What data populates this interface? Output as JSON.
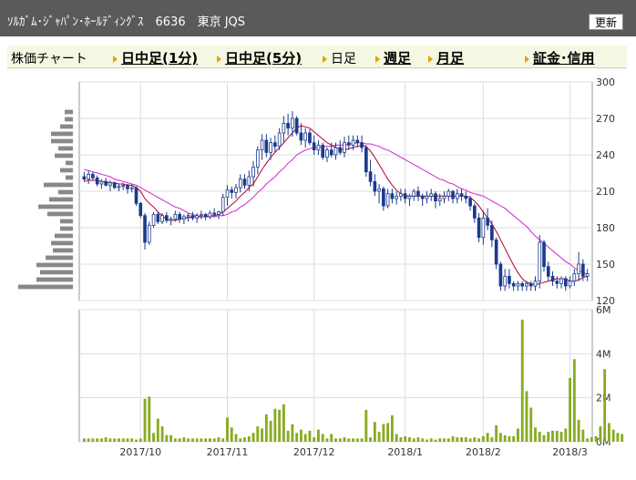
{
  "title_bar": {
    "title": "ｿﾙｶﾞﾑ･ｼﾞｬﾊﾟﾝ･ﾎｰﾙﾃﾞｨﾝｸﾞｽ　6636　東京 JQS",
    "refresh_label": "更新"
  },
  "nav": {
    "label": "株価チャート",
    "items": [
      {
        "label": "日中足(1分)",
        "link": true
      },
      {
        "label": "日中足(5分)",
        "link": true
      },
      {
        "label": "日足",
        "link": false
      },
      {
        "label": "週足",
        "link": true
      },
      {
        "label": "月足",
        "link": true
      },
      {
        "label": "証金･信用",
        "link": true
      }
    ]
  },
  "colors": {
    "up_candle": "#ffffff",
    "down_candle": "#1a3a8c",
    "ma_short": "#aa0033",
    "ma_long": "#cc22cc",
    "volume": "#88aa22",
    "profile": "#888888",
    "nav_arrow": "#e8a000"
  },
  "chart_data": {
    "type": "candlestick",
    "price_axis": {
      "ticks": [
        "300",
        "270",
        "240",
        "210",
        "180",
        "150",
        "120"
      ],
      "ylim": [
        120,
        300
      ]
    },
    "volume_axis": {
      "ticks": [
        "6M",
        "4M",
        "2M",
        "0M"
      ],
      "ylim": [
        0,
        6000000
      ]
    },
    "x_labels": [
      "2017/10",
      "2017/11",
      "2017/12",
      "2018/1",
      "2018/2",
      "2018/3"
    ],
    "x_label_index": [
      13,
      33,
      53,
      74,
      92,
      112
    ],
    "candles": [
      [
        222,
        226,
        218,
        220
      ],
      [
        220,
        227,
        216,
        224
      ],
      [
        224,
        226,
        219,
        221
      ],
      [
        221,
        223,
        214,
        216
      ],
      [
        216,
        220,
        212,
        218
      ],
      [
        218,
        221,
        214,
        215
      ],
      [
        215,
        219,
        210,
        217
      ],
      [
        217,
        218,
        212,
        213
      ],
      [
        213,
        216,
        210,
        214
      ],
      [
        214,
        217,
        211,
        215
      ],
      [
        215,
        216,
        208,
        212
      ],
      [
        212,
        215,
        209,
        213
      ],
      [
        213,
        214,
        198,
        200
      ],
      [
        200,
        201,
        188,
        190
      ],
      [
        190,
        192,
        162,
        168
      ],
      [
        168,
        185,
        166,
        182
      ],
      [
        182,
        193,
        180,
        191
      ],
      [
        191,
        193,
        183,
        185
      ],
      [
        185,
        192,
        183,
        190
      ],
      [
        190,
        193,
        184,
        186
      ],
      [
        186,
        189,
        182,
        187
      ],
      [
        187,
        194,
        185,
        191
      ],
      [
        191,
        193,
        184,
        187
      ],
      [
        187,
        191,
        183,
        189
      ],
      [
        189,
        192,
        185,
        190
      ],
      [
        190,
        193,
        186,
        188
      ],
      [
        188,
        192,
        184,
        190
      ],
      [
        190,
        194,
        187,
        191
      ],
      [
        191,
        192,
        186,
        189
      ],
      [
        189,
        194,
        187,
        192
      ],
      [
        192,
        196,
        189,
        191
      ],
      [
        191,
        194,
        187,
        193
      ],
      [
        193,
        208,
        190,
        205
      ],
      [
        205,
        215,
        198,
        211
      ],
      [
        211,
        214,
        204,
        209
      ],
      [
        209,
        216,
        204,
        213
      ],
      [
        213,
        224,
        209,
        220
      ],
      [
        220,
        224,
        212,
        215
      ],
      [
        215,
        227,
        210,
        222
      ],
      [
        222,
        235,
        214,
        230
      ],
      [
        230,
        247,
        224,
        244
      ],
      [
        244,
        257,
        236,
        252
      ],
      [
        252,
        257,
        238,
        242
      ],
      [
        242,
        254,
        236,
        250
      ],
      [
        250,
        256,
        242,
        247
      ],
      [
        247,
        262,
        244,
        258
      ],
      [
        258,
        272,
        250,
        266
      ],
      [
        266,
        274,
        256,
        262
      ],
      [
        262,
        276,
        255,
        270
      ],
      [
        270,
        272,
        256,
        258
      ],
      [
        258,
        266,
        248,
        252
      ],
      [
        252,
        262,
        246,
        258
      ],
      [
        258,
        261,
        248,
        250
      ],
      [
        250,
        256,
        240,
        244
      ],
      [
        244,
        252,
        240,
        248
      ],
      [
        248,
        250,
        236,
        238
      ],
      [
        238,
        246,
        234,
        244
      ],
      [
        244,
        250,
        238,
        240
      ],
      [
        240,
        250,
        236,
        246
      ],
      [
        246,
        252,
        240,
        242
      ],
      [
        242,
        255,
        238,
        250
      ],
      [
        250,
        256,
        244,
        248
      ],
      [
        248,
        256,
        244,
        252
      ],
      [
        252,
        256,
        246,
        250
      ],
      [
        250,
        256,
        242,
        246
      ],
      [
        246,
        248,
        222,
        226
      ],
      [
        226,
        236,
        214,
        218
      ],
      [
        218,
        224,
        206,
        210
      ],
      [
        210,
        216,
        200,
        212
      ],
      [
        212,
        214,
        194,
        198
      ],
      [
        198,
        212,
        196,
        208
      ],
      [
        208,
        212,
        200,
        204
      ],
      [
        204,
        210,
        199,
        206
      ],
      [
        206,
        212,
        202,
        208
      ],
      [
        208,
        212,
        200,
        204
      ],
      [
        204,
        208,
        198,
        206
      ],
      [
        206,
        212,
        202,
        210
      ],
      [
        210,
        214,
        202,
        206
      ],
      [
        206,
        208,
        198,
        204
      ],
      [
        204,
        210,
        200,
        206
      ],
      [
        206,
        212,
        202,
        208
      ],
      [
        208,
        210,
        196,
        202
      ],
      [
        202,
        208,
        198,
        204
      ],
      [
        204,
        210,
        200,
        206
      ],
      [
        206,
        212,
        202,
        210
      ],
      [
        210,
        211,
        200,
        204
      ],
      [
        204,
        212,
        200,
        208
      ],
      [
        208,
        212,
        202,
        206
      ],
      [
        206,
        210,
        200,
        204
      ],
      [
        204,
        206,
        194,
        198
      ],
      [
        198,
        200,
        184,
        188
      ],
      [
        188,
        192,
        168,
        172
      ],
      [
        172,
        194,
        166,
        188
      ],
      [
        188,
        196,
        178,
        182
      ],
      [
        182,
        186,
        164,
        170
      ],
      [
        170,
        172,
        146,
        150
      ],
      [
        150,
        152,
        128,
        132
      ],
      [
        132,
        146,
        128,
        140
      ],
      [
        140,
        146,
        130,
        134
      ],
      [
        134,
        136,
        128,
        132
      ],
      [
        132,
        136,
        128,
        134
      ],
      [
        134,
        136,
        128,
        132
      ],
      [
        132,
        136,
        128,
        134
      ],
      [
        134,
        136,
        128,
        132
      ],
      [
        132,
        140,
        128,
        136
      ],
      [
        136,
        174,
        130,
        168
      ],
      [
        168,
        170,
        144,
        148
      ],
      [
        148,
        152,
        136,
        140
      ],
      [
        140,
        144,
        132,
        136
      ],
      [
        136,
        140,
        130,
        134
      ],
      [
        134,
        140,
        130,
        138
      ],
      [
        138,
        140,
        128,
        132
      ],
      [
        132,
        140,
        130,
        136
      ],
      [
        136,
        146,
        132,
        142
      ],
      [
        142,
        160,
        136,
        150
      ],
      [
        150,
        154,
        136,
        140
      ],
      [
        140,
        146,
        136,
        142
      ]
    ],
    "ma_short": [
      218,
      219,
      219,
      219,
      218,
      218,
      217,
      217,
      216,
      216,
      215,
      215,
      213,
      210,
      204,
      200,
      197,
      193,
      190,
      187,
      186,
      186,
      187,
      188,
      188,
      189,
      189,
      189,
      189,
      190,
      190,
      191,
      193,
      196,
      199,
      202,
      206,
      209,
      213,
      216,
      222,
      228,
      233,
      238,
      242,
      246,
      250,
      254,
      258,
      262,
      264,
      263,
      262,
      259,
      256,
      253,
      250,
      248,
      246,
      245,
      244,
      245,
      246,
      247,
      248,
      247,
      243,
      238,
      232,
      226,
      220,
      215,
      211,
      208,
      206,
      206,
      206,
      206,
      206,
      206,
      206,
      206,
      206,
      206,
      206,
      206,
      206,
      206,
      206,
      205,
      202,
      198,
      193,
      188,
      183,
      177,
      170,
      163,
      156,
      149,
      143,
      138,
      135,
      134,
      133,
      134,
      135,
      136,
      137,
      138,
      138,
      138,
      136,
      136,
      137,
      139,
      140
    ],
    "ma_long": [
      228,
      227,
      226,
      225,
      224,
      223,
      222,
      220,
      219,
      218,
      217,
      216,
      215,
      213,
      211,
      209,
      207,
      205,
      203,
      201,
      199,
      197,
      196,
      194,
      192,
      191,
      190,
      189,
      189,
      189,
      189,
      190,
      190,
      191,
      193,
      194,
      197,
      199,
      202,
      205,
      209,
      212,
      216,
      219,
      222,
      226,
      229,
      233,
      236,
      240,
      242,
      244,
      245,
      246,
      246,
      247,
      247,
      247,
      248,
      248,
      248,
      249,
      249,
      250,
      250,
      249,
      249,
      248,
      247,
      245,
      244,
      242,
      240,
      238,
      236,
      234,
      232,
      230,
      228,
      226,
      224,
      222,
      220,
      219,
      217,
      216,
      214,
      212,
      211,
      209,
      208,
      207,
      206,
      204,
      202,
      200,
      198,
      196,
      193,
      190,
      187,
      184,
      181,
      177,
      173,
      170,
      167,
      164,
      161,
      158,
      155,
      152,
      150,
      147,
      145,
      143,
      142
    ],
    "volume_m": [
      0.15,
      0.15,
      0.15,
      0.15,
      0.15,
      0.2,
      0.15,
      0.15,
      0.15,
      0.15,
      0.15,
      0.15,
      0.1,
      0.15,
      1.95,
      2.05,
      0.4,
      1.05,
      0.7,
      0.3,
      0.3,
      0.15,
      0.15,
      0.2,
      0.15,
      0.15,
      0.15,
      0.15,
      0.15,
      0.15,
      0.15,
      0.2,
      0.15,
      1.1,
      0.65,
      0.35,
      0.15,
      0.2,
      0.25,
      0.4,
      0.7,
      0.6,
      1.25,
      0.95,
      1.5,
      1.45,
      1.7,
      0.5,
      0.8,
      0.4,
      0.55,
      0.35,
      0.5,
      0.2,
      0.55,
      0.35,
      0.15,
      0.35,
      0.15,
      0.15,
      0.2,
      0.15,
      0.15,
      0.15,
      0.15,
      1.45,
      0.2,
      0.9,
      0.45,
      0.8,
      0.85,
      1.2,
      0.35,
      0.2,
      0.25,
      0.2,
      0.15,
      0.2,
      0.15,
      0.1,
      0.15,
      0.1,
      0.15,
      0.15,
      0.15,
      0.25,
      0.2,
      0.2,
      0.2,
      0.15,
      0.2,
      0.15,
      0.25,
      0.4,
      0.2,
      0.75,
      0.4,
      0.3,
      0.25,
      0.25,
      0.6,
      5.55,
      2.3,
      1.55,
      0.65,
      0.45,
      0.3,
      0.45,
      0.5,
      0.5,
      0.45,
      0.6,
      2.9,
      3.75,
      1.0,
      0.55,
      0.15,
      0.2,
      0.25,
      0.7,
      3.3,
      0.85,
      0.55,
      0.4,
      0.35
    ],
    "price_profile": [
      {
        "price": 275,
        "vol": 9
      },
      {
        "price": 269,
        "vol": 9
      },
      {
        "price": 263,
        "vol": 14
      },
      {
        "price": 257,
        "vol": 24
      },
      {
        "price": 251,
        "vol": 24
      },
      {
        "price": 245,
        "vol": 16
      },
      {
        "price": 239,
        "vol": 20
      },
      {
        "price": 233,
        "vol": 8
      },
      {
        "price": 227,
        "vol": 14
      },
      {
        "price": 221,
        "vol": 8
      },
      {
        "price": 215,
        "vol": 32
      },
      {
        "price": 209,
        "vol": 16
      },
      {
        "price": 203,
        "vol": 26
      },
      {
        "price": 197,
        "vol": 38
      },
      {
        "price": 191,
        "vol": 28
      },
      {
        "price": 185,
        "vol": 14
      },
      {
        "price": 179,
        "vol": 14
      },
      {
        "price": 173,
        "vol": 20
      },
      {
        "price": 167,
        "vol": 24
      },
      {
        "price": 161,
        "vol": 22
      },
      {
        "price": 155,
        "vol": 30
      },
      {
        "price": 149,
        "vol": 40
      },
      {
        "price": 143,
        "vol": 36
      },
      {
        "price": 137,
        "vol": 40
      },
      {
        "price": 131,
        "vol": 60
      }
    ]
  }
}
